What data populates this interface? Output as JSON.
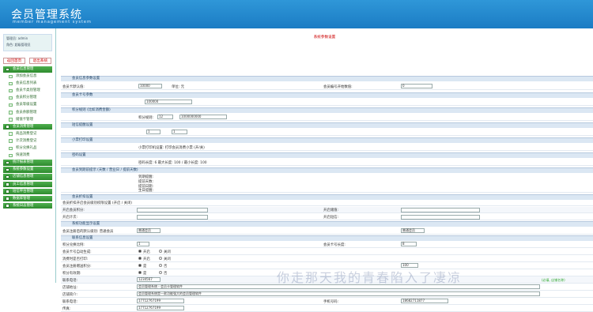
{
  "app": {
    "title": "会员管理系统",
    "subtitle": "member management system"
  },
  "sidebar": {
    "user_lines": [
      "管理员: admin",
      "角色: 超级管理员"
    ],
    "tabs": [
      "返回首页",
      "退出系统"
    ],
    "items": [
      {
        "label": "会员信息管理",
        "type": "group"
      },
      {
        "label": "添加会员信息",
        "type": "sub"
      },
      {
        "label": "会员信息列表",
        "type": "sub"
      },
      {
        "label": "会员卡类别管理",
        "type": "sub"
      },
      {
        "label": "会员积分管理",
        "type": "sub"
      },
      {
        "label": "会员等级设置",
        "type": "sub"
      },
      {
        "label": "会员余额管理",
        "type": "sub"
      },
      {
        "label": "储值卡管理",
        "type": "sub"
      },
      {
        "label": "会员消费管理",
        "type": "group"
      },
      {
        "label": "商品消费登记",
        "type": "sub"
      },
      {
        "label": "计次消费登记",
        "type": "sub"
      },
      {
        "label": "积分兑换礼品",
        "type": "sub"
      },
      {
        "label": "快速消费",
        "type": "sub"
      },
      {
        "label": "统计报表管理",
        "type": "group"
      },
      {
        "label": "系统参数设置",
        "type": "group"
      },
      {
        "label": "店铺信息管理",
        "type": "group"
      },
      {
        "label": "员工信息管理",
        "type": "group"
      },
      {
        "label": "短信平台管理",
        "type": "group"
      },
      {
        "label": "数据库管理",
        "type": "group"
      },
      {
        "label": "系统日志管理",
        "type": "group"
      }
    ]
  },
  "main": {
    "page_title": "系统参数设置",
    "sections": {
      "s1": "会员信息参数设置",
      "s2": "会员卡号参数",
      "s3": "积分规则 (比如消费金额)",
      "s4": "短信提醒设置",
      "s5": "小票打印设置",
      "s6": "密码设置",
      "s7": "会员到期前提示 (天数 / 营业日 / 提前天数)",
      "s8": "会员折扣设置",
      "s9": "系统功能显示设置",
      "s10": "联系信息设置"
    },
    "fields": {
      "r1_label": "会员卡默认值:",
      "r1_val": "10000",
      "r1_mid": "单位: 元",
      "r1_right_label": "会员编号开始数值:",
      "r1_right_val": "0",
      "r2_val": "100000",
      "r3_label": "积分规则:",
      "r3_val": "12",
      "r3_val2": "1000000000",
      "r4_val": "1",
      "r4_val2": "1",
      "r5_line": "小票打印机设置: 打印会员消费小票 (开/关)",
      "r6_line": "密码长度: 6 最大长度: 100 / 最小长度: 100",
      "r7_a": "到期提醒:",
      "r7_b": "提前天数:",
      "r7_c": "提前日期:",
      "r7_d": "生日提醒:",
      "r8_label": "会员折扣开启会员级别权限设置 (开启 / 关闭)",
      "r9_label1": "开启会员积分:",
      "r9_label2": "开启储值:",
      "r9_label3": "开启计次:",
      "r9_label4": "开启短信:",
      "r10_label": "会员注册后的默认级别: 普通会员",
      "r10_v1": "普通会员",
      "r10_v2": "普通会员",
      "r11_label": "积分兑换比例:",
      "r11_val": "1",
      "r12_label": "会员卡号自动生成:",
      "r12_right": "会员卡号长度:",
      "r12_right_val": "8",
      "r13_label": "消费时是否打印:",
      "r14_label": "会员注册赠送积分:",
      "r14_right_val": "100",
      "r15_label": "积分有效期:",
      "r16_contact": "联系电话:",
      "r16_contact_val": "1234567",
      "r16_hint": "(必填, 店铺名称)",
      "r17_label": "店铺地址:",
      "r17_val": "会员管理系统 - 会员卡管理软件",
      "r18_label": "店铺简介:",
      "r18_val": "会员管理系统是一款功能强大的会员管理软件",
      "r19_tel1": "联系电话:",
      "r19_tel1_val": "17712767199",
      "r19_tel2": "手机号码:",
      "r19_tel2_val": "18682711877",
      "r20_fax": "传真:",
      "r20_fax_val": "17712767199",
      "r21_label": "客服QQ:",
      "r21_val": "adminadmin"
    },
    "radio_on": "开启",
    "radio_off": "关闭",
    "radio_yes": "是",
    "radio_no": "否"
  },
  "watermark": "你走那天我的青春陷入了凄凉"
}
